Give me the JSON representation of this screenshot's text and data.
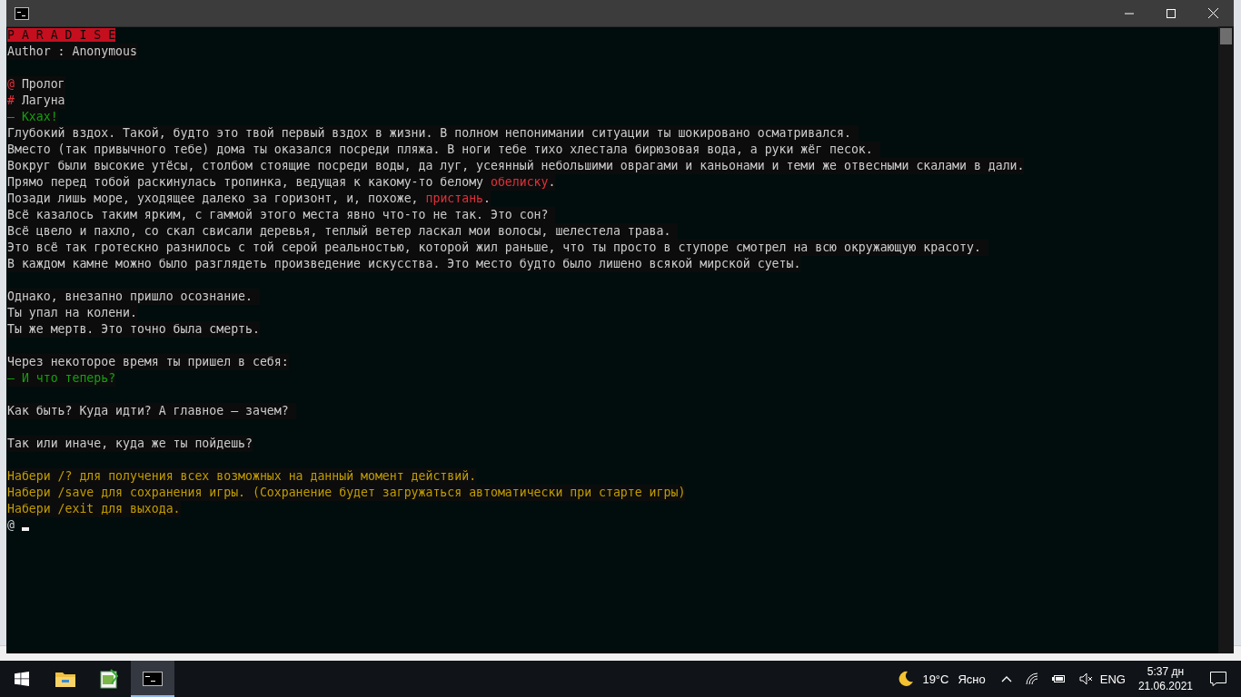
{
  "console": {
    "lines": [
      {
        "kind": "text",
        "segments": [
          {
            "text": "P A R A D I S E",
            "kind": "title"
          }
        ]
      },
      {
        "kind": "text",
        "segments": [
          {
            "text": "Author : Anonymous",
            "kind": "normal"
          }
        ]
      },
      {
        "kind": "blank"
      },
      {
        "kind": "text",
        "segments": [
          {
            "text": "@",
            "kind": "red"
          },
          {
            "text": " Пролог",
            "kind": "normal"
          }
        ]
      },
      {
        "kind": "text",
        "segments": [
          {
            "text": "#",
            "kind": "red"
          },
          {
            "text": " Лагуна",
            "kind": "normal"
          }
        ]
      },
      {
        "kind": "text",
        "segments": [
          {
            "text": "– Кхах!",
            "kind": "green"
          }
        ]
      },
      {
        "kind": "text",
        "segments": [
          {
            "text": "Глубокий вздох. Такой, будто это твой первый вздох в жизни. В полном непонимании ситуации ты шокировано осматривался. ",
            "kind": "normal"
          }
        ]
      },
      {
        "kind": "text",
        "segments": [
          {
            "text": "Вместо (так привычного тебе) дома ты оказался посреди пляжа. В ноги тебе тихо хлестала бирюзовая вода, а руки жёг песок. ",
            "kind": "normal"
          }
        ]
      },
      {
        "kind": "text",
        "segments": [
          {
            "text": "Вокруг были высокие утёсы, столбом стоящие посреди воды, да луг, усеянный небольшими оврагами и каньонами и теми же отвесными скалами в дали.",
            "kind": "normal"
          }
        ]
      },
      {
        "kind": "text",
        "segments": [
          {
            "text": "Прямо перед тобой раскинулась тропинка, ведущая к какому-то белому ",
            "kind": "normal"
          },
          {
            "text": "обелиску",
            "kind": "red"
          },
          {
            "text": ".",
            "kind": "normal"
          }
        ]
      },
      {
        "kind": "text",
        "segments": [
          {
            "text": "Позади лишь море, уходящее далеко за горизонт, и, похоже, ",
            "kind": "normal"
          },
          {
            "text": "пристань",
            "kind": "red"
          },
          {
            "text": ".",
            "kind": "normal"
          }
        ]
      },
      {
        "kind": "text",
        "segments": [
          {
            "text": "Всё казалось таким ярким, с гаммой этого места явно что-то не так. Это сон? ",
            "kind": "normal"
          }
        ]
      },
      {
        "kind": "text",
        "segments": [
          {
            "text": "Всё цвело и пахло, со скал свисали деревья, теплый ветер ласкал мои волосы, шелестела трава. ",
            "kind": "normal"
          }
        ]
      },
      {
        "kind": "text",
        "segments": [
          {
            "text": "Это всё так гротескно разнилось с той серой реальностью, которой жил раньше, что ты просто в ступоре смотрел на всю окружающую красоту. ",
            "kind": "normal"
          }
        ]
      },
      {
        "kind": "text",
        "segments": [
          {
            "text": "В каждом камне можно было разглядеть произведение искусства. Это место будто было лишено всякой мирской суеты.",
            "kind": "normal"
          }
        ]
      },
      {
        "kind": "blank"
      },
      {
        "kind": "text",
        "segments": [
          {
            "text": "Однако, внезапно пришло осознание. ",
            "kind": "normal"
          }
        ]
      },
      {
        "kind": "text",
        "segments": [
          {
            "text": "Ты упал на колени.",
            "kind": "normal"
          }
        ]
      },
      {
        "kind": "text",
        "segments": [
          {
            "text": "Ты же мертв. Это точно была смерть.",
            "kind": "normal"
          }
        ]
      },
      {
        "kind": "blank"
      },
      {
        "kind": "text",
        "segments": [
          {
            "text": "Через некоторое время ты пришел в себя:",
            "kind": "normal"
          }
        ]
      },
      {
        "kind": "text",
        "segments": [
          {
            "text": "– И что теперь?",
            "kind": "green"
          }
        ]
      },
      {
        "kind": "blank"
      },
      {
        "kind": "text",
        "segments": [
          {
            "text": "Как быть? Куда идти? А главное – зачем? ",
            "kind": "normal"
          }
        ]
      },
      {
        "kind": "blank"
      },
      {
        "kind": "text",
        "segments": [
          {
            "text": "Так или иначе, куда же ты пойдешь?",
            "kind": "normal"
          }
        ]
      },
      {
        "kind": "blank"
      },
      {
        "kind": "text",
        "segments": [
          {
            "text": "Набери /? для получения всех возможных на данный момент действий.",
            "kind": "orange"
          }
        ]
      },
      {
        "kind": "text",
        "segments": [
          {
            "text": "Набери /save для сохранения игры. (Сохранение будет загружаться автоматически при старте игры)",
            "kind": "orange"
          }
        ]
      },
      {
        "kind": "text",
        "segments": [
          {
            "text": "Набери /exit для выхода.",
            "kind": "orange"
          }
        ]
      }
    ],
    "prompt": {
      "symbol": "@",
      "cursor": true
    }
  },
  "taskbar": {
    "apps": [
      {
        "kind": "explorer",
        "selected": false
      },
      {
        "kind": "notepad",
        "selected": false
      },
      {
        "kind": "console",
        "selected": true
      }
    ],
    "weather": {
      "temperature": "19°C",
      "condition": "Ясно"
    },
    "language": "ENG",
    "time": "5:37 дн",
    "date": "21.06.2021"
  }
}
